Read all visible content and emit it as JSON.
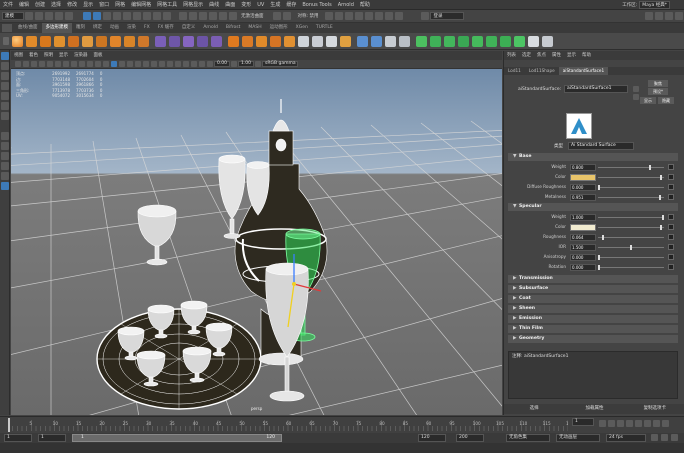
{
  "menubar": {
    "items": [
      "文件",
      "编辑",
      "创建",
      "选择",
      "修改",
      "显示",
      "窗口",
      "网格",
      "编辑网格",
      "网格工具",
      "网格显示",
      "曲线",
      "曲面",
      "变形",
      "UV",
      "生成",
      "缓存",
      "Bonus Tools",
      "Arnold",
      "帮助"
    ],
    "workspace_label": "工作区:",
    "workspace_value": "Maya 经典*"
  },
  "statusline": {
    "mode": "建模",
    "no_live_surface": "无激活曲面",
    "symmetry": "对称: 禁用",
    "login": "登录"
  },
  "shelf_tabs": [
    "曲线/曲面",
    "多边形建模",
    "雕刻",
    "绑定",
    "动画",
    "渲染",
    "FX",
    "FX 缓存",
    "自定义",
    "Arnold",
    "Bifrost",
    "MASH",
    "运动图形",
    "XGen",
    "TURTLE"
  ],
  "shelf_active_tab": "多边形建模",
  "panel_menu": [
    "视图",
    "着色",
    "照明",
    "显示",
    "渲染器",
    "面板"
  ],
  "panel_tools": {
    "exposure": "0.00",
    "gamma": "1.00",
    "colorspace": "sRGB gamma"
  },
  "hud": {
    "rows": [
      {
        "label": "顶点:",
        "a": "2691992",
        "b": "2691774",
        "c": "0"
      },
      {
        "label": "边:",
        "a": "7703148",
        "b": "7702604",
        "c": "0"
      },
      {
        "label": "面:",
        "a": "3961598",
        "b": "3961866",
        "c": "0"
      },
      {
        "label": "三角形:",
        "a": "7713978",
        "b": "7703736",
        "c": "0"
      },
      {
        "label": "UV:",
        "a": "9054072",
        "b": "3015634",
        "c": "0"
      }
    ]
  },
  "viewport_camera": "persp",
  "attr_editor": {
    "top_menu": [
      "列表",
      "选定",
      "焦点",
      "属性",
      "显示",
      "帮助"
    ],
    "node_tabs": [
      "Lod11",
      "Lod11Shape",
      "aiStandardSurface1"
    ],
    "active_tab": "aiStandardSurface1",
    "shader_label": "aiStandardSurface:",
    "shader_name": "aiStandardSurface1",
    "buttons": {
      "focus": "聚焦",
      "presets": "预设*",
      "show": "显示",
      "hide": "隐藏"
    },
    "type_label": "类型",
    "type_value": "Ai Standard Surface",
    "sections": {
      "base": "Base",
      "specular": "Specular",
      "collapsed": [
        "Transmission",
        "Subsurface",
        "Coat",
        "Sheen",
        "Emission",
        "Thin Film",
        "Geometry"
      ]
    },
    "base_attrs": [
      {
        "label": "Weight",
        "value": "0.800",
        "level": 0.8
      },
      {
        "label": "Color",
        "swatch": "#e8c46a"
      },
      {
        "label": "Diffuse Roughness",
        "value": "0.000",
        "level": 0.0
      },
      {
        "label": "Metalness",
        "value": "0.951",
        "level": 0.951
      }
    ],
    "specular_attrs": [
      {
        "label": "Weight",
        "value": "1.000",
        "level": 1.0
      },
      {
        "label": "Color",
        "swatch": "#f2ecd0"
      },
      {
        "label": "Roughness",
        "value": "0.064",
        "level": 0.064
      },
      {
        "label": "IOR",
        "value": "1.500",
        "level": 0.5
      },
      {
        "label": "Anisotropy",
        "value": "0.000",
        "level": 0.0
      },
      {
        "label": "Rotation",
        "value": "0.000",
        "level": 0.0
      }
    ],
    "notes_label": "注释: aiStandardSurface1",
    "bottom_buttons": [
      "选择",
      "加载属性",
      "复制选项卡"
    ]
  },
  "timeline": {
    "ticks": [
      "5",
      "10",
      "15",
      "20",
      "25",
      "30",
      "35",
      "40",
      "45",
      "50",
      "55",
      "60",
      "65",
      "70",
      "75",
      "80",
      "85",
      "90",
      "95",
      "100",
      "105",
      "110",
      "115",
      "12"
    ],
    "current_frame": "1"
  },
  "range": {
    "start": "1",
    "inner_start": "1",
    "inner_end": "120",
    "end": "120",
    "anim_end": "200",
    "charset": "无角色集",
    "anim_layer": "无动画层",
    "fps": "24 fps"
  },
  "colors": {
    "accent": "#3d7ab8",
    "selection_green": "#2fdc5a"
  }
}
